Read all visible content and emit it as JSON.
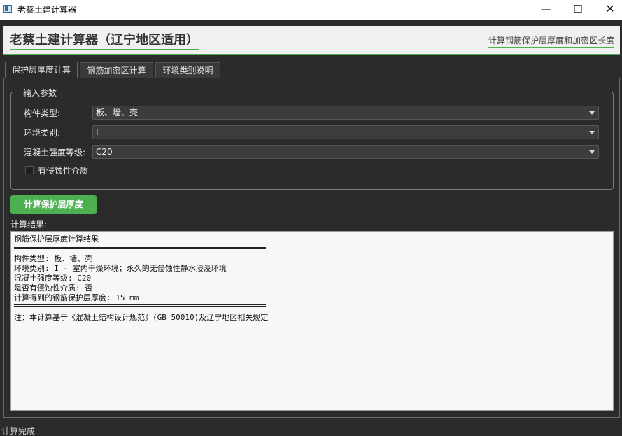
{
  "window": {
    "title": "老蔡土建计算器",
    "minimize": "—",
    "maximize": "☐",
    "close": "✕"
  },
  "header": {
    "title": "老蔡土建计算器（辽宁地区适用）",
    "subtitle": "计算钢筋保护层厚度和加密区长度"
  },
  "tabs": [
    {
      "label": "保护层厚度计算",
      "active": true
    },
    {
      "label": "钢筋加密区计算",
      "active": false
    },
    {
      "label": "环境类别说明",
      "active": false
    }
  ],
  "input_group": {
    "legend": "输入参数",
    "member_type": {
      "label": "构件类型:",
      "value": "板、墙、壳"
    },
    "env_class": {
      "label": "环境类别:",
      "value": "I"
    },
    "concrete_grade": {
      "label": "混凝土强度等级:",
      "value": "C20"
    },
    "corrosive": {
      "label": "有侵蚀性介质",
      "checked": false
    }
  },
  "calc_button": "计算保护层厚度",
  "result_label": "计算结果:",
  "result": {
    "heading": "钢筋保护层厚度计算结果",
    "lines": [
      "构件类型: 板、墙、壳",
      "环境类别: I - 室内干燥环境；永久的无侵蚀性静水浸没环境",
      "混凝土强度等级: C20",
      "是否有侵蚀性介质: 否",
      "计算得到的钢筋保护层厚度: 15 mm"
    ],
    "note": "注：本计算基于《混凝土结构设计规范》(GB 50010)及辽宁地区相关规定"
  },
  "status": "计算完成"
}
